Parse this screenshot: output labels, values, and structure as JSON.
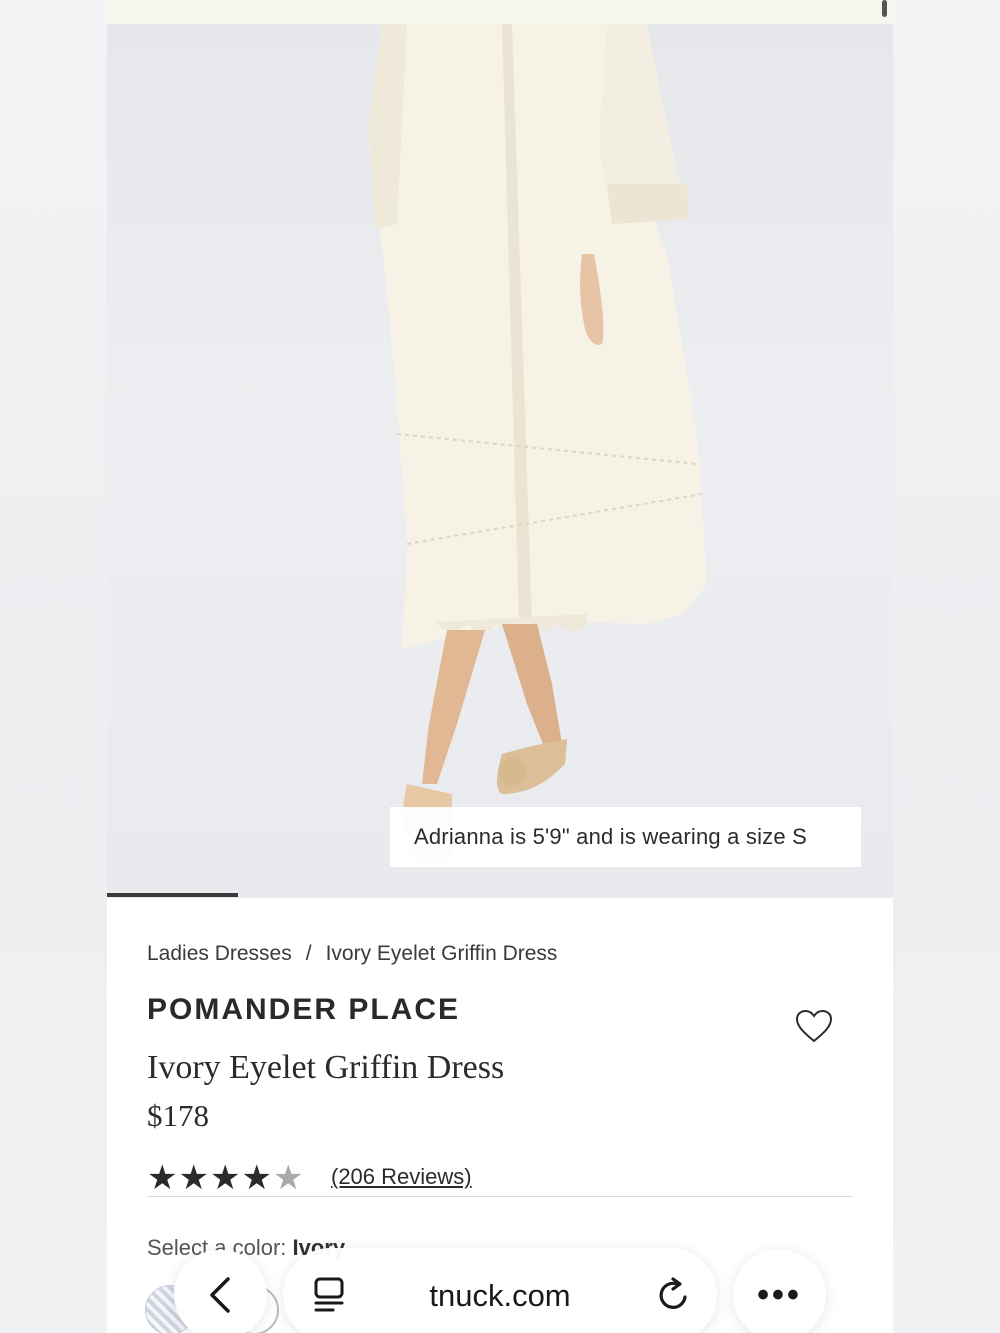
{
  "hero": {
    "model_caption": "Adrianna is 5'9\" and is wearing a size S",
    "image_description": "product-photo-ivory-eyelet-dress"
  },
  "breadcrumb": {
    "items": [
      "Ladies Dresses",
      "Ivory Eyelet Griffin Dress"
    ],
    "separator": "/"
  },
  "product": {
    "brand": "POMANDER PLACE",
    "title": "Ivory Eyelet Griffin Dress",
    "price": "$178",
    "rating": 4,
    "rating_max": 5,
    "reviews_label": "(206 Reviews)"
  },
  "color": {
    "label": "Select a color:",
    "selected": "Ivory"
  },
  "browser": {
    "url": "tnuck.com",
    "more_label": "•••"
  },
  "colors": {
    "page_bg": "#ffffff",
    "top_strip": "#f7f6ec",
    "text": "#2b2b2b"
  }
}
